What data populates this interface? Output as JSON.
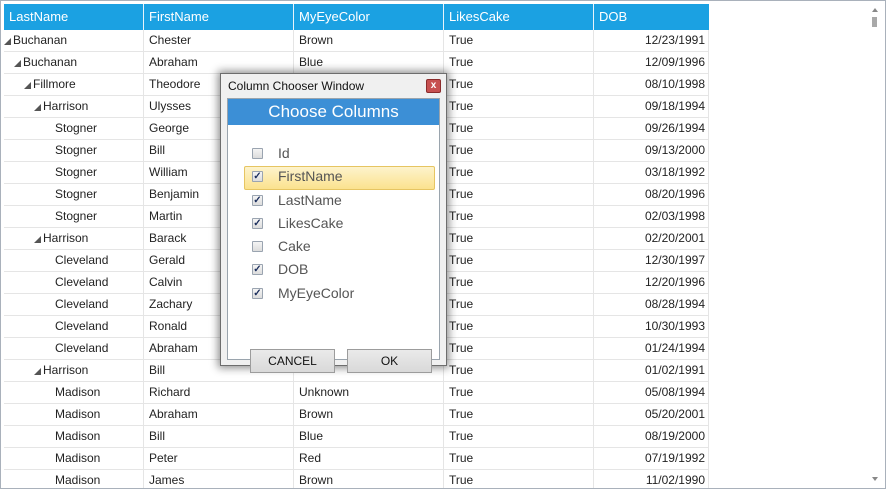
{
  "grid": {
    "columns": [
      "LastName",
      "FirstName",
      "MyEyeColor",
      "LikesCake",
      "DOB"
    ],
    "rows": [
      {
        "level": 0,
        "expander": true,
        "cells": [
          "Buchanan",
          "Chester",
          "Brown",
          "True",
          "12/23/1991"
        ]
      },
      {
        "level": 1,
        "expander": true,
        "cells": [
          "Buchanan",
          "Abraham",
          "Blue",
          "True",
          "12/09/1996"
        ]
      },
      {
        "level": 2,
        "expander": true,
        "cells": [
          "Fillmore",
          "Theodore",
          "",
          "True",
          "08/10/1998"
        ]
      },
      {
        "level": 3,
        "expander": true,
        "cells": [
          "Harrison",
          "Ulysses",
          "",
          "True",
          "09/18/1994"
        ]
      },
      {
        "level": 4,
        "expander": false,
        "cells": [
          "Stogner",
          "George",
          "",
          "True",
          "09/26/1994"
        ]
      },
      {
        "level": 4,
        "expander": false,
        "cells": [
          "Stogner",
          "Bill",
          "",
          "True",
          "09/13/2000"
        ]
      },
      {
        "level": 4,
        "expander": false,
        "cells": [
          "Stogner",
          "William",
          "",
          "True",
          "03/18/1992"
        ]
      },
      {
        "level": 4,
        "expander": false,
        "cells": [
          "Stogner",
          "Benjamin",
          "",
          "True",
          "08/20/1996"
        ]
      },
      {
        "level": 4,
        "expander": false,
        "cells": [
          "Stogner",
          "Martin",
          "",
          "True",
          "02/03/1998"
        ]
      },
      {
        "level": 3,
        "expander": true,
        "cells": [
          "Harrison",
          "Barack",
          "",
          "True",
          "02/20/2001"
        ]
      },
      {
        "level": 4,
        "expander": false,
        "cells": [
          "Cleveland",
          "Gerald",
          "",
          "True",
          "12/30/1997"
        ]
      },
      {
        "level": 4,
        "expander": false,
        "cells": [
          "Cleveland",
          "Calvin",
          "",
          "True",
          "12/20/1996"
        ]
      },
      {
        "level": 4,
        "expander": false,
        "cells": [
          "Cleveland",
          "Zachary",
          "",
          "True",
          "08/28/1994"
        ]
      },
      {
        "level": 4,
        "expander": false,
        "cells": [
          "Cleveland",
          "Ronald",
          "",
          "True",
          "10/30/1993"
        ]
      },
      {
        "level": 4,
        "expander": false,
        "cells": [
          "Cleveland",
          "Abraham",
          "",
          "True",
          "01/24/1994"
        ]
      },
      {
        "level": 3,
        "expander": true,
        "cells": [
          "Harrison",
          "Bill",
          "",
          "True",
          "01/02/1991"
        ]
      },
      {
        "level": 4,
        "expander": false,
        "cells": [
          "Madison",
          "Richard",
          "Unknown",
          "True",
          "05/08/1994"
        ]
      },
      {
        "level": 4,
        "expander": false,
        "cells": [
          "Madison",
          "Abraham",
          "Brown",
          "True",
          "05/20/2001"
        ]
      },
      {
        "level": 4,
        "expander": false,
        "cells": [
          "Madison",
          "Bill",
          "Blue",
          "True",
          "08/19/2000"
        ]
      },
      {
        "level": 4,
        "expander": false,
        "cells": [
          "Madison",
          "Peter",
          "Red",
          "True",
          "07/19/1992"
        ]
      },
      {
        "level": 4,
        "expander": false,
        "cells": [
          "Madison",
          "James",
          "Brown",
          "True",
          "11/02/1990"
        ]
      }
    ]
  },
  "dialog": {
    "window_title": "Column Chooser Window",
    "close_label": "x",
    "header": "Choose Columns",
    "columns": [
      {
        "label": "Id",
        "checked": false,
        "selected": false
      },
      {
        "label": "FirstName",
        "checked": true,
        "selected": true
      },
      {
        "label": "LastName",
        "checked": true,
        "selected": false
      },
      {
        "label": "LikesCake",
        "checked": true,
        "selected": false
      },
      {
        "label": "Cake",
        "checked": false,
        "selected": false
      },
      {
        "label": "DOB",
        "checked": true,
        "selected": false
      },
      {
        "label": "MyEyeColor",
        "checked": true,
        "selected": false
      }
    ],
    "cancel_label": "CANCEL",
    "ok_label": "OK"
  },
  "check_glyph": "✓"
}
